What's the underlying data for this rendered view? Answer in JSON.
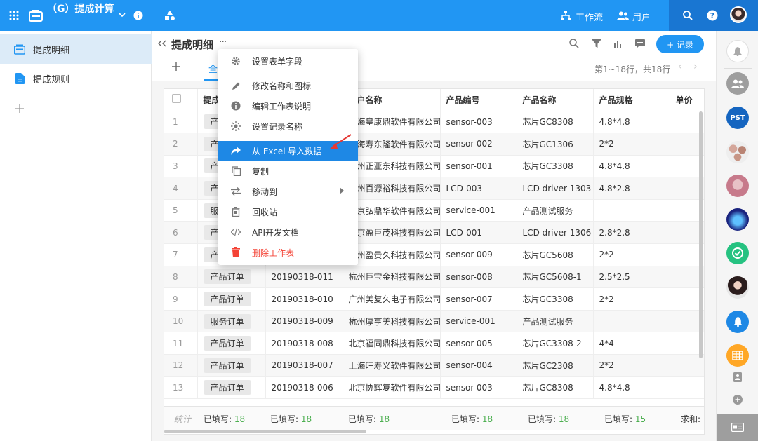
{
  "topbar": {
    "app_title": "（G）提成计算",
    "workflow_label": "工作流",
    "users_label": "用户"
  },
  "sidebar": {
    "items": [
      {
        "label": "提成明细"
      },
      {
        "label": "提成规则"
      }
    ]
  },
  "sheet": {
    "title": "提成明细",
    "tab_all": "全部",
    "add_record_label": "+ 记录",
    "pagination": "第1~18行，共18行"
  },
  "table": {
    "columns": [
      "提成",
      "",
      "客户名称",
      "产品编号",
      "产品名称",
      "产品规格",
      "单价"
    ],
    "rows": [
      {
        "n": "1",
        "type": "产品",
        "order": "",
        "customer": "上海皇康鼎软件有限公司",
        "code": "sensor-003",
        "product": "芯片GC8308",
        "spec": "4.8*4.8"
      },
      {
        "n": "2",
        "type": "产品",
        "order": "",
        "customer": "上海寿东隆软件有限公司",
        "code": "sensor-002",
        "product": "芯片GC1306",
        "spec": "2*2"
      },
      {
        "n": "3",
        "type": "产品",
        "order": "",
        "customer": "杭州正亚东科技有限公司",
        "code": "sensor-001",
        "product": "芯片GC3308",
        "spec": "4.8*4.8"
      },
      {
        "n": "4",
        "type": "产品",
        "order": "",
        "customer": "杭州百源裕科技有限公司",
        "code": "LCD-003",
        "product": "LCD driver 1303",
        "spec": "4.8*2.8"
      },
      {
        "n": "5",
        "type": "服务",
        "order": "",
        "customer": "北京弘鼎华软件有限公司",
        "code": "service-001",
        "product": "产品测试服务",
        "spec": ""
      },
      {
        "n": "6",
        "type": "产品",
        "order": "",
        "customer": "北京盈巨茂科技有限公司",
        "code": "LCD-001",
        "product": "LCD driver 1306",
        "spec": "2.8*2.8"
      },
      {
        "n": "7",
        "type": "产品",
        "order": "",
        "customer": "杭州盈贵久科技有限公司",
        "code": "sensor-009",
        "product": "芯片GC5608",
        "spec": "2*2"
      },
      {
        "n": "8",
        "type": "产品订单",
        "order": "20190318-011",
        "customer": "杭州巨宝金科技有限公司",
        "code": "sensor-008",
        "product": "芯片GC5608-1",
        "spec": "2.5*2.5"
      },
      {
        "n": "9",
        "type": "产品订单",
        "order": "20190318-010",
        "customer": "广州美复久电子有限公司",
        "code": "sensor-007",
        "product": "芯片GC3308",
        "spec": "2*2"
      },
      {
        "n": "10",
        "type": "服务订单",
        "order": "20190318-009",
        "customer": "杭州厚亨美科技有限公司",
        "code": "service-001",
        "product": "产品测试服务",
        "spec": ""
      },
      {
        "n": "11",
        "type": "产品订单",
        "order": "20190318-008",
        "customer": "北京福同鼎科技有限公司",
        "code": "sensor-005",
        "product": "芯片GC3308-2",
        "spec": "4*4"
      },
      {
        "n": "12",
        "type": "产品订单",
        "order": "20190318-007",
        "customer": "上海旺寿义软件有限公司",
        "code": "sensor-004",
        "product": "芯片GC2308",
        "spec": "2*2"
      },
      {
        "n": "13",
        "type": "产品订单",
        "order": "20190318-006",
        "customer": "北京协辉复软件有限公司",
        "code": "sensor-003",
        "product": "芯片GC8308",
        "spec": "4.8*4.8"
      }
    ],
    "footer": {
      "label": "统计",
      "filled_prefix": "已填写:",
      "counts": [
        "18",
        "18",
        "18",
        "18",
        "18",
        "15"
      ],
      "sum_label": "求和:"
    }
  },
  "menu": {
    "items": [
      {
        "label": "设置表单字段",
        "icon": "gear-icon"
      },
      {
        "label": "修改名称和图标",
        "icon": "pencil-icon"
      },
      {
        "label": "编辑工作表说明",
        "icon": "info-icon"
      },
      {
        "label": "设置记录名称",
        "icon": "sun-icon"
      },
      {
        "label": "从 Excel 导入数据",
        "icon": "share-arrow-icon"
      },
      {
        "label": "复制",
        "icon": "copy-icon"
      },
      {
        "label": "移动到",
        "icon": "swap-icon"
      },
      {
        "label": "回收站",
        "icon": "recycle-icon"
      },
      {
        "label": "API开发文档",
        "icon": "code-icon"
      },
      {
        "label": "删除工作表",
        "icon": "trash-icon"
      }
    ]
  },
  "rightbar": {
    "pst_label": "PST"
  },
  "colors": {
    "primary": "#2196f3",
    "highlight": "#1e88e5",
    "danger": "#f44336",
    "success": "#4caf50"
  }
}
